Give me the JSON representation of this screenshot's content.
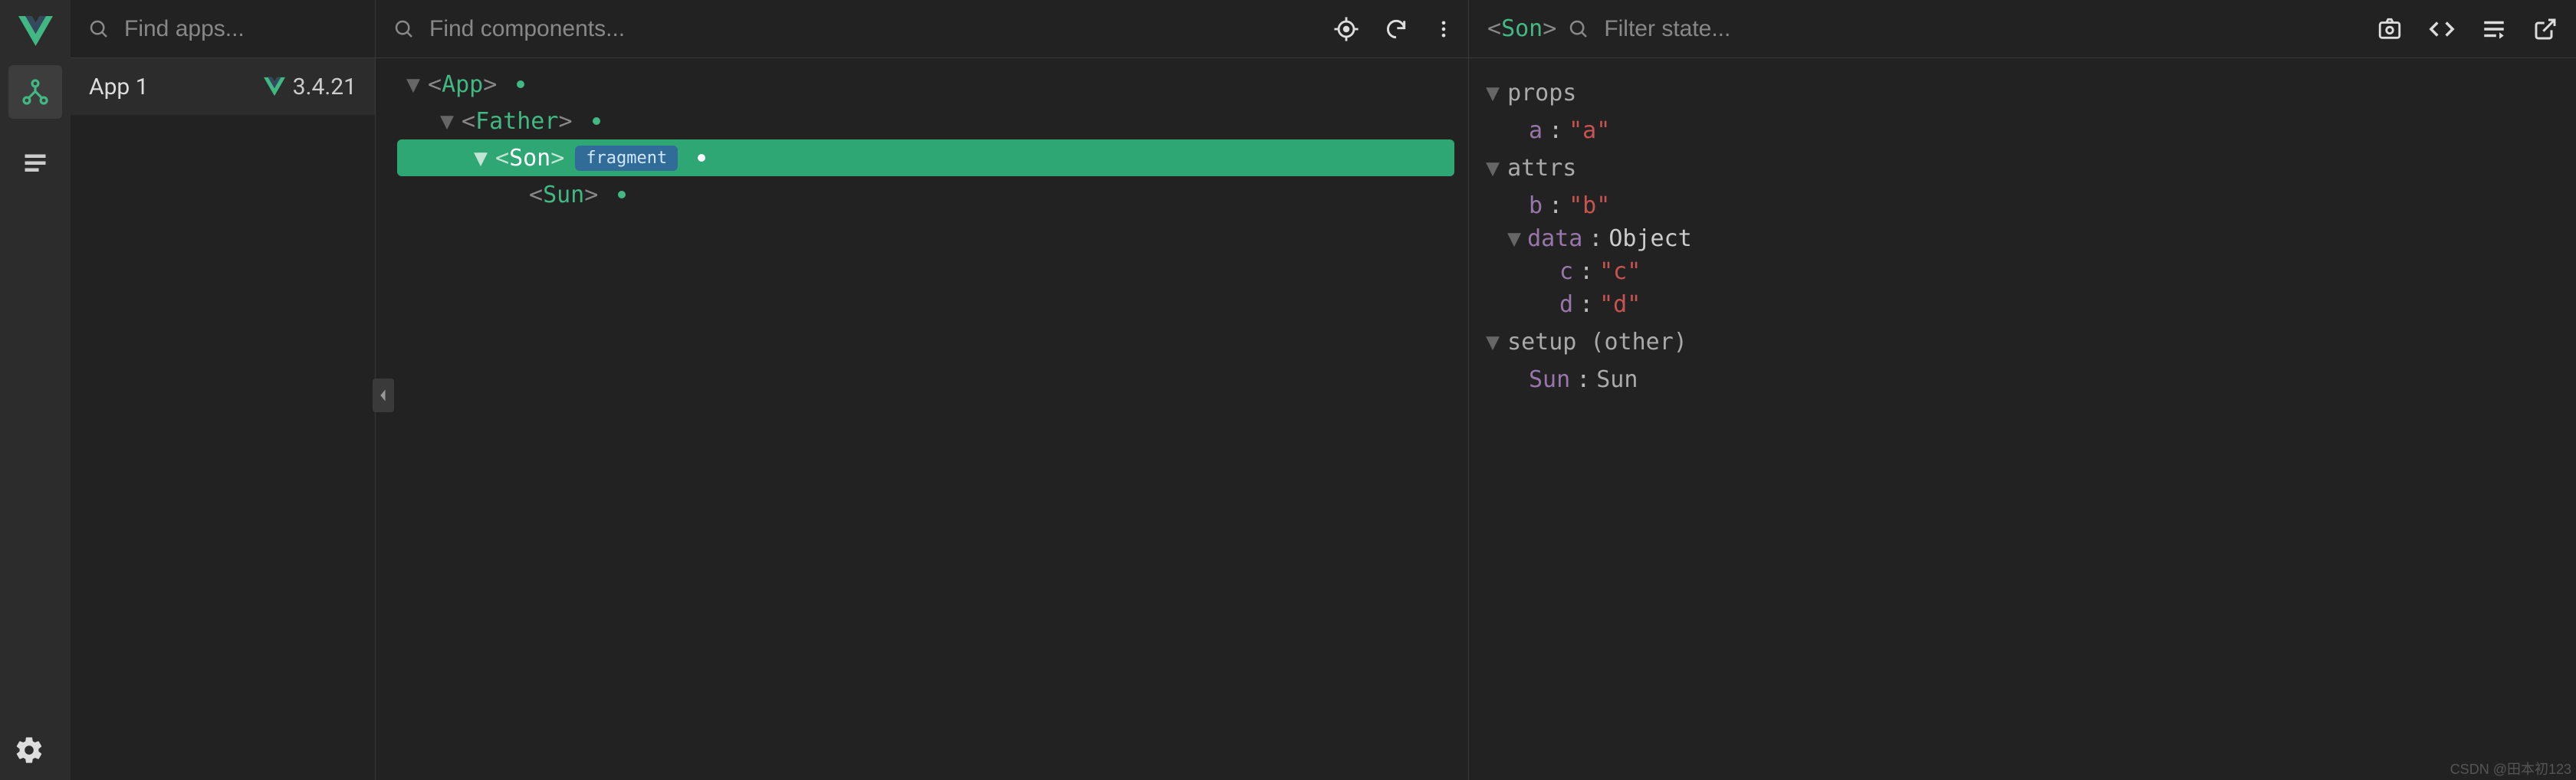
{
  "apps_search_placeholder": "Find apps...",
  "components_search_placeholder": "Find components...",
  "state_filter_placeholder": "Filter state...",
  "app": {
    "name": "App 1",
    "version": "3.4.21"
  },
  "tree": {
    "root": "App",
    "n1": "Father",
    "n2": "Son",
    "n2_badge": "fragment",
    "n3": "Sun"
  },
  "state": {
    "selected_component": "Son",
    "sections": {
      "props": {
        "title": "props",
        "items": [
          {
            "key": "a",
            "value": "\"a\""
          }
        ]
      },
      "attrs": {
        "title": "attrs",
        "items": [
          {
            "key": "b",
            "value": "\"b\""
          }
        ],
        "data_label": "data",
        "data_type": "Object",
        "data_items": [
          {
            "key": "c",
            "value": "\"c\""
          },
          {
            "key": "d",
            "value": "\"d\""
          }
        ]
      },
      "setup": {
        "title": "setup (other)",
        "items": [
          {
            "key": "Sun",
            "value": "Sun"
          }
        ]
      }
    }
  },
  "watermark": "CSDN @田本初123"
}
